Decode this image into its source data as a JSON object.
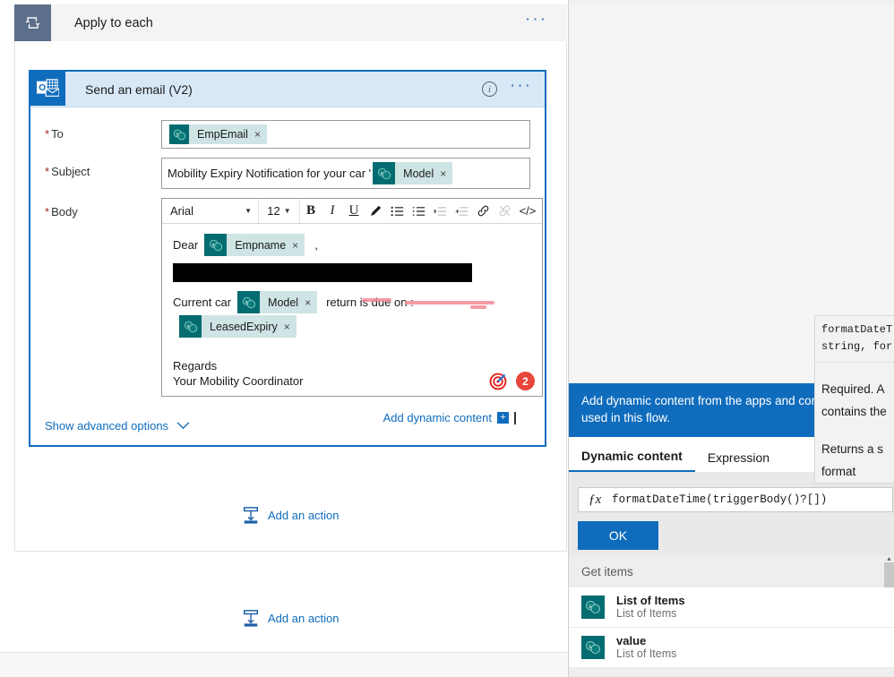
{
  "scope": {
    "title": "Apply to each",
    "icon": "loop-icon",
    "menu": "···"
  },
  "email_card": {
    "title": "Send an email (V2)",
    "icon": "outlook-icon",
    "info": "i",
    "menu": "···",
    "fields": {
      "to": {
        "label": "To",
        "required": "*",
        "tokens": [
          {
            "label": "EmpEmail",
            "remove": "×",
            "icon": "sharepoint-icon"
          }
        ]
      },
      "subject": {
        "label": "Subject",
        "required": "*",
        "text": "Mobility Expiry Notification for your car '",
        "tokens": [
          {
            "label": "Model",
            "remove": "×",
            "icon": "sharepoint-icon"
          }
        ]
      },
      "body": {
        "label": "Body",
        "required": "*"
      }
    },
    "toolbar": {
      "font_family": "Arial",
      "font_size": "12",
      "caret": "▼",
      "buttons": [
        {
          "name": "bold-button",
          "glyph": "B",
          "style": "bold",
          "enabled": true
        },
        {
          "name": "italic-button",
          "glyph": "I",
          "style": "ital",
          "enabled": true
        },
        {
          "name": "underline-button",
          "glyph": "U",
          "style": "und",
          "enabled": true
        },
        {
          "name": "text-color-button",
          "glyph": "✎",
          "style": "",
          "enabled": true
        },
        {
          "name": "bulleted-list-button",
          "glyph": "☰",
          "style": "",
          "enabled": true
        },
        {
          "name": "numbered-list-button",
          "glyph": "☰",
          "style": "",
          "enabled": true
        },
        {
          "name": "decrease-indent-button",
          "glyph": "≡",
          "style": "",
          "enabled": false
        },
        {
          "name": "increase-indent-button",
          "glyph": "≡",
          "style": "",
          "enabled": false
        },
        {
          "name": "insert-link-button",
          "glyph": "🔗",
          "style": "",
          "enabled": true
        },
        {
          "name": "remove-link-button",
          "glyph": "🔗",
          "style": "",
          "enabled": false
        },
        {
          "name": "code-view-button",
          "glyph": "</>",
          "style": "",
          "enabled": true
        }
      ]
    },
    "body_content": {
      "greeting": "Dear",
      "greeting_token": {
        "label": "Empname",
        "remove": "×",
        "icon": "sharepoint-icon"
      },
      "greeting_comma": ",",
      "redacted": "",
      "line_prefix": "Current car",
      "car_token": {
        "label": "Model",
        "remove": "×",
        "icon": "sharepoint-icon"
      },
      "line_middle": "return is due on :",
      "date_token": {
        "label": "LeasedExpiry",
        "remove": "×",
        "icon": "sharepoint-icon"
      },
      "sign_off_1": "Regards",
      "sign_off_2": "Your Mobility Coordinator"
    },
    "annotations": {
      "target_icon": "target-icon",
      "step_badge": "2"
    },
    "add_dynamic_content": {
      "label": "Add dynamic content",
      "plus": "+"
    },
    "advanced_options": {
      "label": "Show advanced options",
      "chevron": "⌄"
    }
  },
  "add_actions": [
    {
      "label": "Add an action",
      "icon": "add-action-icon"
    },
    {
      "label": "Add an action",
      "icon": "add-action-icon"
    }
  ],
  "dynamic_panel": {
    "banner": "Add dynamic content from the apps and connectors used in this flow.",
    "tabs": [
      {
        "label": "Dynamic content",
        "active": true
      },
      {
        "label": "Expression",
        "active": false
      }
    ],
    "expression": {
      "fx": "ƒx",
      "value": "formatDateTime(triggerBody()?[])"
    },
    "ok_label": "OK",
    "group_header": "Get items",
    "items": [
      {
        "title": "List of Items",
        "subtitle": "List of Items",
        "icon": "sharepoint-icon"
      },
      {
        "title": "value",
        "subtitle": "List of Items",
        "icon": "sharepoint-icon"
      }
    ]
  },
  "tooltip": {
    "signature_line1": "formatDateT",
    "signature_line2": "string, for",
    "para1_line1": "Required.   A",
    "para1_line2": "contains the",
    "para2_line1": "Returns   a   s",
    "para2_line2": "format"
  },
  "colors": {
    "accent_blue": "#0f6cbd",
    "sharepoint_teal": "#036c70",
    "token_bg": "#cfe4e4",
    "required_red": "#a4262c",
    "annotation_red": "#e8463c",
    "highlighter_pink": "#f58a96",
    "scope_icon_bg": "#5c6f8a",
    "card_header_bg": "#d9e8f7"
  }
}
